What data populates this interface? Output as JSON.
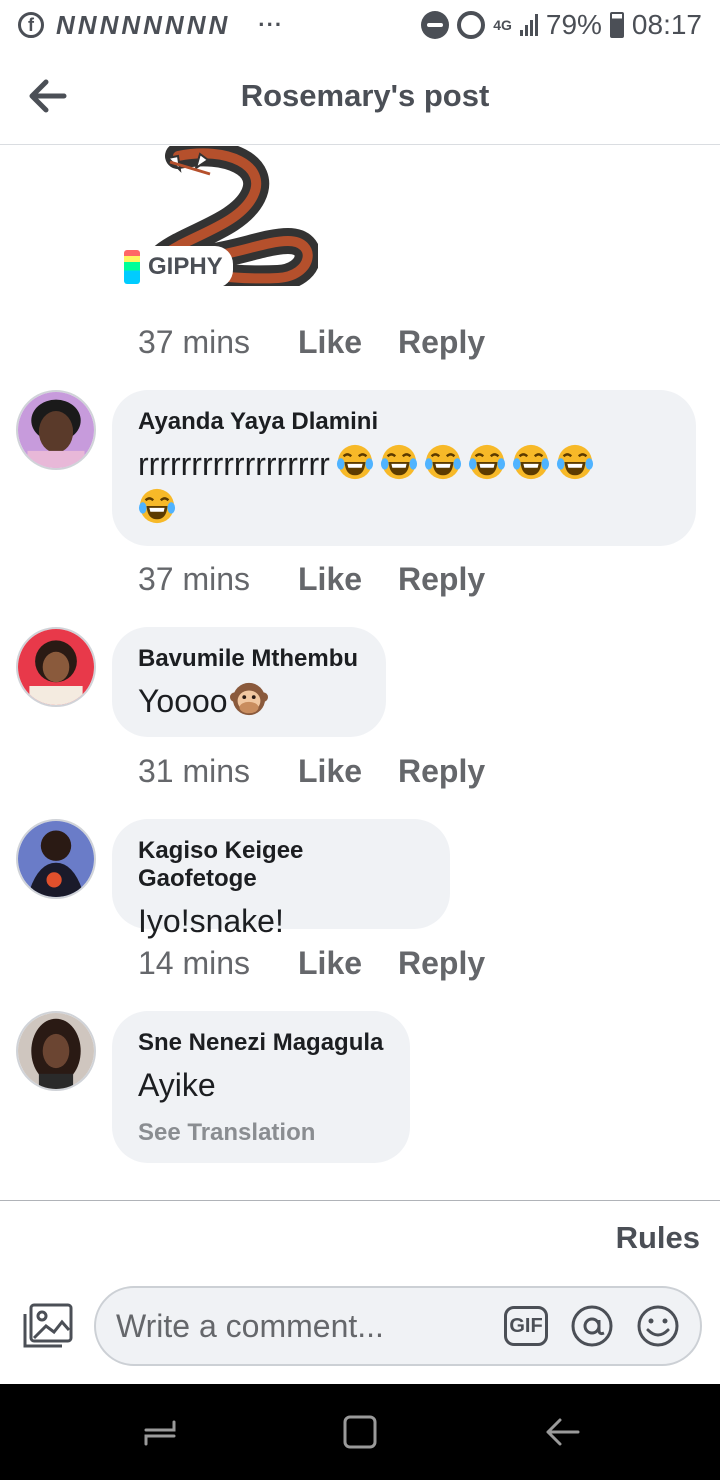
{
  "status_bar": {
    "fb_glyph": "f",
    "notification_icons": [
      "N",
      "N",
      "N",
      "N",
      "N",
      "N",
      "N",
      "N"
    ],
    "more": "···",
    "network": "4G",
    "battery": "79%",
    "battery_level": 0.79,
    "time": "08:17"
  },
  "header": {
    "title": "Rosemary's post"
  },
  "giphy": {
    "label": "GIPHY"
  },
  "first_comment_actions": {
    "time": "37 mins",
    "like": "Like",
    "reply": "Reply"
  },
  "comments": [
    {
      "name": "Ayanda Yaya Dlamini",
      "text": "rrrrrrrrrrrrrrrrrr",
      "emoji": [
        "laughing-crying-emoji",
        "laughing-crying-emoji",
        "laughing-crying-emoji",
        "laughing-crying-emoji",
        "laughing-crying-emoji",
        "laughing-crying-emoji",
        "laughing-crying-emoji"
      ],
      "time": "37 mins",
      "like": "Like",
      "reply": "Reply"
    },
    {
      "name": "Bavumile Mthembu",
      "text": "Yoooo",
      "emoji": [
        "speak-no-evil-monkey-emoji"
      ],
      "time": "31 mins",
      "like": "Like",
      "reply": "Reply"
    },
    {
      "name": "Kagiso Keigee Gaofetoge",
      "text": "Iyo!snake!",
      "time": "14 mins",
      "like": "Like",
      "reply": "Reply"
    },
    {
      "name": "Sne Nenezi Magagula",
      "text": "Ayike",
      "see_translation": "See Translation"
    }
  ],
  "footer": {
    "rules": "Rules",
    "comment_placeholder": "Write a comment...",
    "gif_label": "GIF"
  },
  "colors": {
    "bubble": "#f0f2f5",
    "text_secondary": "#65676b",
    "header_text": "#4b4f56"
  }
}
